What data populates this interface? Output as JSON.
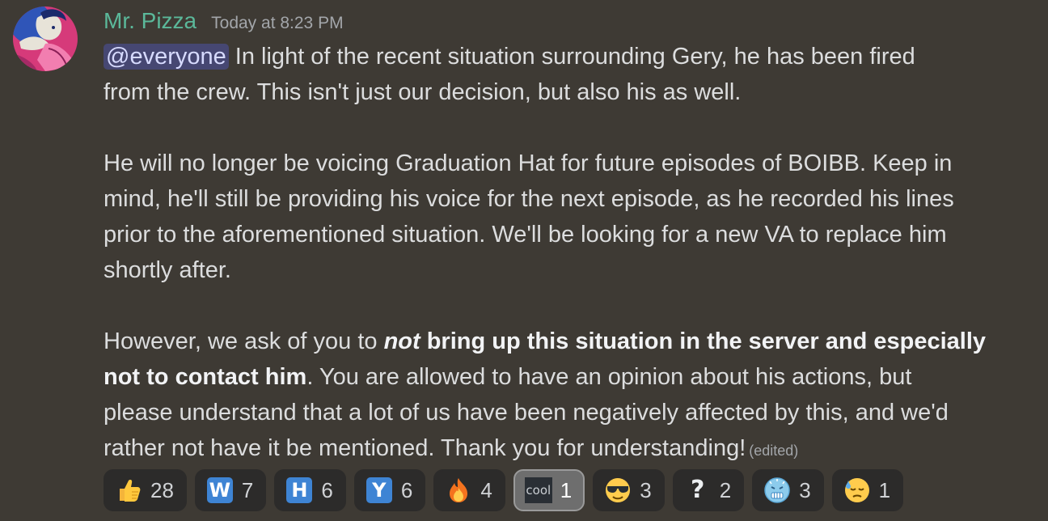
{
  "message": {
    "author": "Mr. Pizza",
    "timestamp": "Today at 8:23 PM",
    "mention": "@everyone",
    "lines": {
      "l1_rest": " In light of the recent situation surrounding Gery, he has been fired",
      "l2": "from the crew. This isn't just our decision, but also his as well.",
      "l3": "He will no longer be voicing Graduation Hat for future episodes of BOIBB. Keep in",
      "l4": "mind, he'll still be providing his voice for the next episode, as he recorded his lines",
      "l5": "prior to the aforementioned situation. We'll be looking for a new VA to replace him",
      "l6": "shortly after.",
      "l7_a": "However, we ask of you to ",
      "l7_em": "not",
      "l7_b": " bring up this situation in the server and especially",
      "l8_strong": "not to contact him",
      "l8_rest": ". You are allowed to have an opinion about his actions, but",
      "l9": "please understand that a lot of us have been negatively affected by this, and we'd",
      "l10": "rather not have it be mentioned. Thank you for understanding!"
    },
    "edited": "(edited)"
  },
  "reactions": [
    {
      "emoji": "thumbs-up-icon",
      "count": "28"
    },
    {
      "emoji": "regional-w-icon",
      "letter": "W",
      "count": "7"
    },
    {
      "emoji": "regional-h-icon",
      "letter": "H",
      "count": "6"
    },
    {
      "emoji": "regional-y-icon",
      "letter": "Y",
      "count": "6"
    },
    {
      "emoji": "fire-icon",
      "count": "4"
    },
    {
      "emoji": "cool-emote",
      "label": "cool",
      "count": "1",
      "active": true
    },
    {
      "emoji": "sunglasses-face-icon",
      "count": "3"
    },
    {
      "emoji": "question-mark-icon",
      "label": "?",
      "count": "2"
    },
    {
      "emoji": "cold-face-icon",
      "count": "3"
    },
    {
      "emoji": "downcast-sweat-face-icon",
      "count": "1"
    }
  ],
  "colors": {
    "background": "#3e3a34",
    "username": "#5bb89a",
    "mention_bg": "#5865f2",
    "reaction_bg": "#2c2b2a",
    "reaction_active_bg": "#6e6e6e"
  }
}
